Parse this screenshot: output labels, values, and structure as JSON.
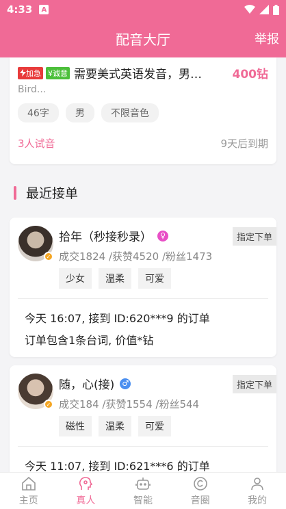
{
  "status_bar": {
    "time": "4:33",
    "notif_icon": "A"
  },
  "header": {
    "title": "配音大厅",
    "report": "举报"
  },
  "order": {
    "tag_urgent": "加急",
    "tag_sincere": "¥诚意",
    "title": "需要美式英语发音，男…",
    "price": "400钻",
    "desc": "Bird...",
    "chips": [
      "46字",
      "男",
      "不限音色"
    ],
    "trials": "3人试音",
    "expire": "9天后到期"
  },
  "section": {
    "label": "最近接单"
  },
  "users": [
    {
      "name": "拾年（秒接秒录）",
      "gender": "♀",
      "assign": "指定下单",
      "stats": "成交1824 /获赞4520 /粉丝1473",
      "tags": [
        "少女",
        "温柔",
        "可爱"
      ],
      "line1": "今天 16:07, 接到 ID:620***9 的订单",
      "line2": "订单包含1条台词, 价值*钻"
    },
    {
      "name": "随，心(接)",
      "gender": "♂",
      "assign": "指定下单",
      "stats": "成交184 /获赞1554 /粉丝544",
      "tags": [
        "磁性",
        "温柔",
        "可爱"
      ],
      "line1": "今天 11:07, 接到 ID:621***6 的订单"
    }
  ],
  "tabbar": [
    {
      "label": "主页",
      "icon": "home-icon"
    },
    {
      "label": "真人",
      "icon": "person-mic-icon"
    },
    {
      "label": "智能",
      "icon": "robot-icon"
    },
    {
      "label": "音圈",
      "icon": "circle-icon"
    },
    {
      "label": "我的",
      "icon": "user-icon"
    }
  ],
  "accent_color": "#f06a96"
}
